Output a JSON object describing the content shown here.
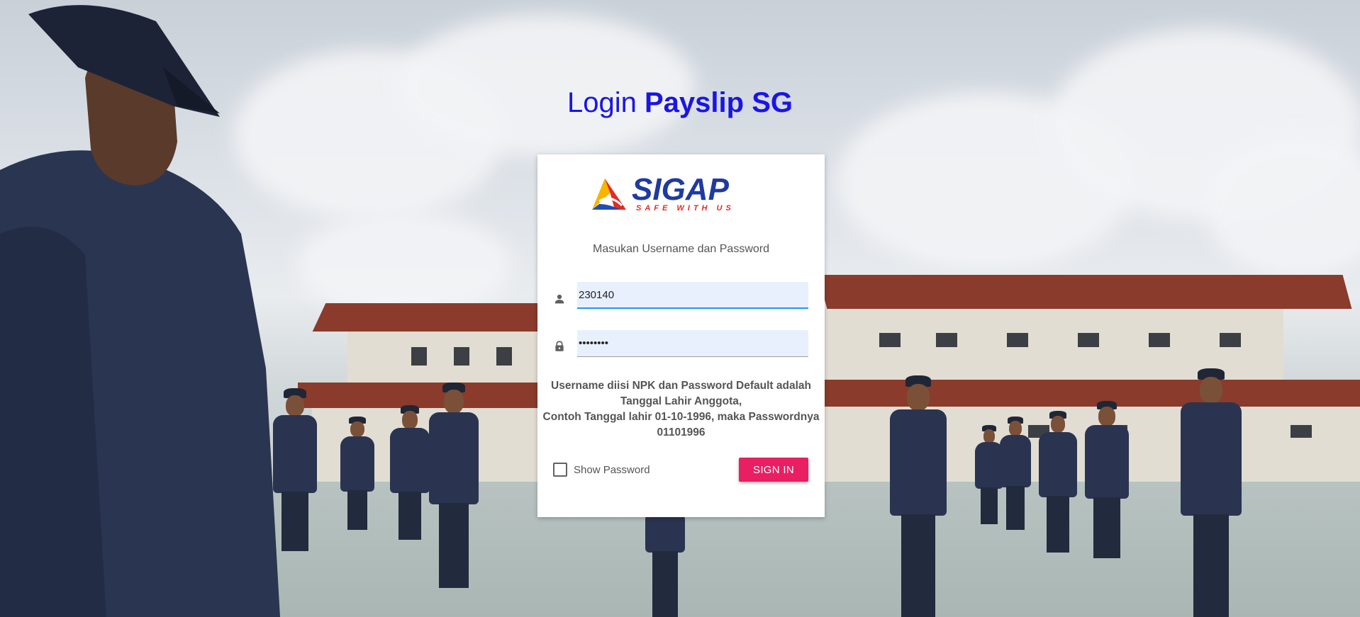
{
  "colors": {
    "title": "#1a15e6",
    "button": "#e91e63",
    "input_bg": "#e8f0fe",
    "focus_underline": "#2196f3"
  },
  "page": {
    "title_prefix": "Login ",
    "title_strong": "Payslip SG"
  },
  "card": {
    "logo": {
      "name": "SIGAP",
      "tagline": "SAFE WITH US"
    },
    "subtitle": "Masukan Username dan Password",
    "username": {
      "icon": "person-icon",
      "value": "230140"
    },
    "password": {
      "icon": "lock-icon",
      "value": "••••••••"
    },
    "notice": {
      "line1": "Username diisi NPK dan Password Default adalah Tanggal Lahir Anggota,",
      "line2": "Contoh Tanggal lahir 01-10-1996, maka Passwordnya 01101996"
    },
    "show_password_label": "Show Password",
    "sign_in_label": "SIGN IN"
  }
}
